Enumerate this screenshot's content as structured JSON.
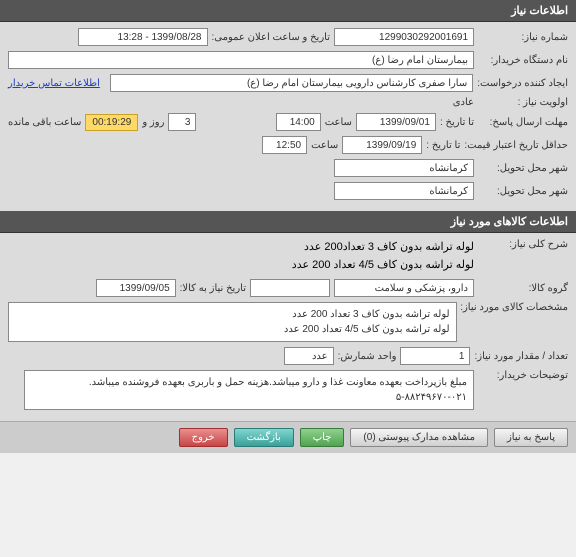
{
  "sections": {
    "info_header": "اطلاعات نیاز",
    "goods_header": "اطلاعات کالاهای مورد نیاز"
  },
  "info": {
    "need_no_label": "شماره نیاز:",
    "need_no": "1299030292001691",
    "announce_label": "تاریخ و ساعت اعلان عمومی:",
    "announce_value": "1399/08/28 - 13:28",
    "buyer_org_label": "نام دستگاه خریدار:",
    "buyer_org": "بیمارستان امام رضا (ع)",
    "creator_label": "ایجاد کننده درخواست:",
    "creator": "سارا صفری کارشناس دارویی بیمارستان امام رضا (ع)",
    "contact_link": "اطلاعات تماس خریدار",
    "priority_label": "اولویت نیاز :",
    "priority": "عادی",
    "deadline_label": "مهلت ارسال پاسخ:",
    "to_date_label": "تا تاریخ :",
    "to_date": "1399/09/01",
    "time_label": "ساعت",
    "deadline_time": "14:00",
    "days": "3",
    "days_label": "روز و",
    "timer": "00:19:29",
    "remain_label": "ساعت باقی مانده",
    "min_validity_label": "حداقل تاریخ اعتبار قیمت:",
    "validity_to_label": "تا تاریخ :",
    "validity_date": "1399/09/19",
    "validity_time": "12:50",
    "delivery_city_label": "شهر محل تحویل:",
    "delivery_city": "کرمانشاه",
    "delivery_city2_label": "شهر محل تحویل:",
    "delivery_city2": "کرمانشاه"
  },
  "goods": {
    "desc_label": "شرح کلی نیاز:",
    "desc_line1": "لوله تراشه بدون کاف 3 تعداد200 عدد",
    "desc_line2": "لوله تراشه بدون کاف 4/5 تعداد 200 عدد",
    "group_label": "گروه کالا:",
    "group": "دارو، پزشکی و سلامت",
    "need_to_date_label": "تاریخ نیاز به کالا:",
    "need_to_date": "1399/09/05",
    "spec_label": "مشخصات کالای مورد نیاز:",
    "spec_line1": "لوله تراشه بدون کاف 3 تعداد 200 عدد",
    "spec_line2": "لوله تراشه بدون کاف 4/5 تعداد 200 عدد",
    "qty_label": "تعداد / مقدار مورد نیاز:",
    "qty": "1",
    "unit_label": "واحد شمارش:",
    "unit": "عدد",
    "buyer_notes_label": "توضیحات خریدار:",
    "buyer_notes": "مبلغ بازپرداخت بعهده معاونت غذا و دارو میباشد.هزینه حمل و باربری بعهده فروشنده میباشد. ۰۲۱-۸۸۲۴۹۶۷۰-۵"
  },
  "buttons": {
    "respond": "پاسخ به نیاز",
    "attachments": "مشاهده مدارک پیوستی (0)",
    "print": "چاپ",
    "back": "بازگشت",
    "exit": "خروج"
  }
}
